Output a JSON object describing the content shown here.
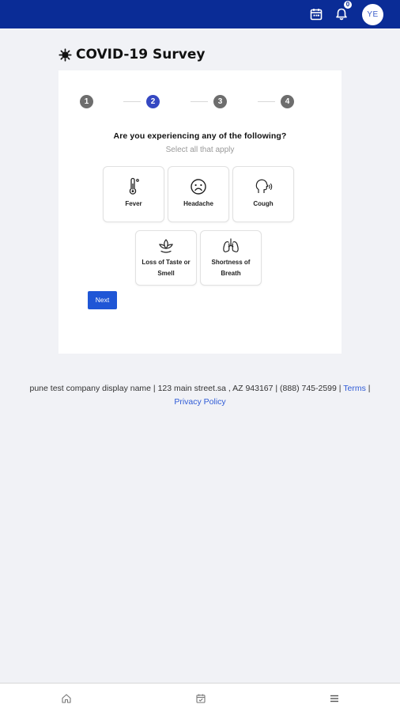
{
  "topbar": {
    "notification_count": "0",
    "avatar_initials": "YE",
    "icons": [
      "calendar-icon",
      "bell-icon"
    ],
    "brand_color": "#0a2c96"
  },
  "page": {
    "title": "COVID-19 Survey",
    "title_icon": "virus-icon"
  },
  "stepper": {
    "steps": [
      "1",
      "2",
      "3",
      "4"
    ],
    "active_step": 2,
    "active_color": "#3548c2"
  },
  "survey": {
    "question": "Are you experiencing any of the following?",
    "subtitle": "Select all that apply",
    "options": [
      {
        "label": "Fever",
        "icon": "thermometer-icon"
      },
      {
        "label": "Headache",
        "icon": "sad-face-icon"
      },
      {
        "label": "Cough",
        "icon": "cough-icon"
      },
      {
        "label_line1": "Loss of Taste or",
        "label_line2": "Smell",
        "icon": "lotus-icon"
      },
      {
        "label_line1": "Shortness of",
        "label_line2": "Breath",
        "icon": "lungs-icon"
      }
    ],
    "next_label": "Next"
  },
  "footer": {
    "text": "pune test company display name | 123 main street.sa , AZ 943167 | (888) 745-2599 |",
    "terms_label": "Terms",
    "separator": "|",
    "privacy_label": "Privacy Policy"
  },
  "bottom_nav": {
    "icons": [
      "home-icon",
      "calendar-check-icon",
      "menu-icon"
    ]
  }
}
